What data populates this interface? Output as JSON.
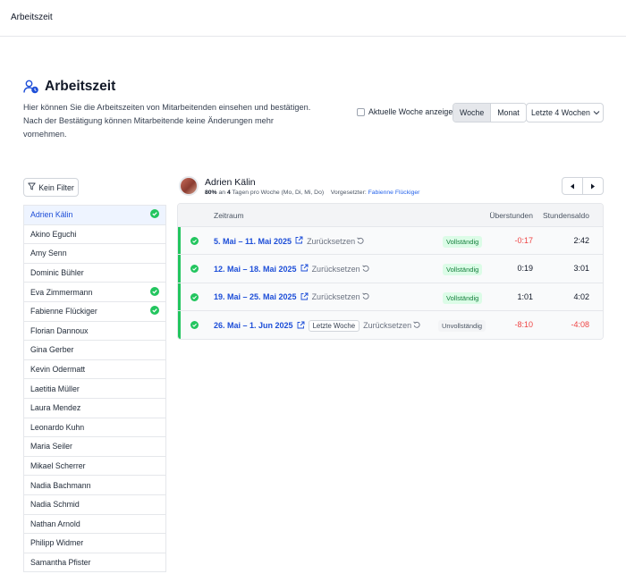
{
  "topbar": {
    "title": "Arbeitszeit"
  },
  "page": {
    "title": "Arbeitszeit",
    "icon": "user-clock-icon",
    "description": "Hier können Sie die Arbeitszeiten von Mitarbeitenden einsehen und bestätigen. Nach der Bestätigung können Mitarbeitende keine Änderungen mehr vornehmen."
  },
  "controls": {
    "current_week_label": "Aktuelle Woche anzeigen",
    "current_week_checked": false,
    "view_week": "Woche",
    "view_month": "Monat",
    "active_view": "Woche",
    "range_selected": "Letzte 4 Wochen"
  },
  "filter": {
    "label": "Kein Filter"
  },
  "employees": [
    {
      "name": "Adrien Kälin",
      "confirmed": true,
      "selected": true
    },
    {
      "name": "Akino Eguchi",
      "confirmed": false
    },
    {
      "name": "Amy Senn",
      "confirmed": false
    },
    {
      "name": "Dominic Bühler",
      "confirmed": false
    },
    {
      "name": "Eva Zimmermann",
      "confirmed": true
    },
    {
      "name": "Fabienne Flückiger",
      "confirmed": true
    },
    {
      "name": "Florian Dannoux",
      "confirmed": false
    },
    {
      "name": "Gina Gerber",
      "confirmed": false
    },
    {
      "name": "Kevin Odermatt",
      "confirmed": false
    },
    {
      "name": "Laetitia Müller",
      "confirmed": false
    },
    {
      "name": "Laura Mendez",
      "confirmed": false
    },
    {
      "name": "Leonardo Kuhn",
      "confirmed": false
    },
    {
      "name": "Maria Seiler",
      "confirmed": false
    },
    {
      "name": "Mikael Scherrer",
      "confirmed": false
    },
    {
      "name": "Nadia Bachmann",
      "confirmed": false
    },
    {
      "name": "Nadia Schmid",
      "confirmed": false
    },
    {
      "name": "Nathan Arnold",
      "confirmed": false
    },
    {
      "name": "Philipp Widmer",
      "confirmed": false
    },
    {
      "name": "Samantha Pfister",
      "confirmed": false
    }
  ],
  "person": {
    "name": "Adrien Kälin",
    "pensum": "80%",
    "meta_mid": " an ",
    "days": "4",
    "meta_rest": " Tagen pro Woche (Mo, Di, Mi, Do)",
    "supervisor_label": "Vorgesetzter: ",
    "supervisor": "Fabienne Flückiger"
  },
  "table": {
    "headers": {
      "period": "Zeitraum",
      "overtime": "Überstunden",
      "balance": "Stundensaldo"
    },
    "reset_label": "Zurücksetzen",
    "rows": [
      {
        "period": "5. Mai – 11. Mai 2025",
        "tag": "",
        "status": "Vollständig",
        "complete": true,
        "overtime": "-0:17",
        "overtime_neg": true,
        "balance": "2:42",
        "balance_neg": false
      },
      {
        "period": "12. Mai – 18. Mai 2025",
        "tag": "",
        "status": "Vollständig",
        "complete": true,
        "overtime": "0:19",
        "overtime_neg": false,
        "balance": "3:01",
        "balance_neg": false
      },
      {
        "period": "19. Mai – 25. Mai 2025",
        "tag": "",
        "status": "Vollständig",
        "complete": true,
        "overtime": "1:01",
        "overtime_neg": false,
        "balance": "4:02",
        "balance_neg": false
      },
      {
        "period": "26. Mai – 1. Jun 2025",
        "tag": "Letzte Woche",
        "status": "Unvollständig",
        "complete": false,
        "overtime": "-8:10",
        "overtime_neg": true,
        "balance": "-4:08",
        "balance_neg": true
      }
    ]
  },
  "colors": {
    "accent": "#1d4ed8",
    "success": "#22c55e",
    "negative": "#ef4444"
  }
}
